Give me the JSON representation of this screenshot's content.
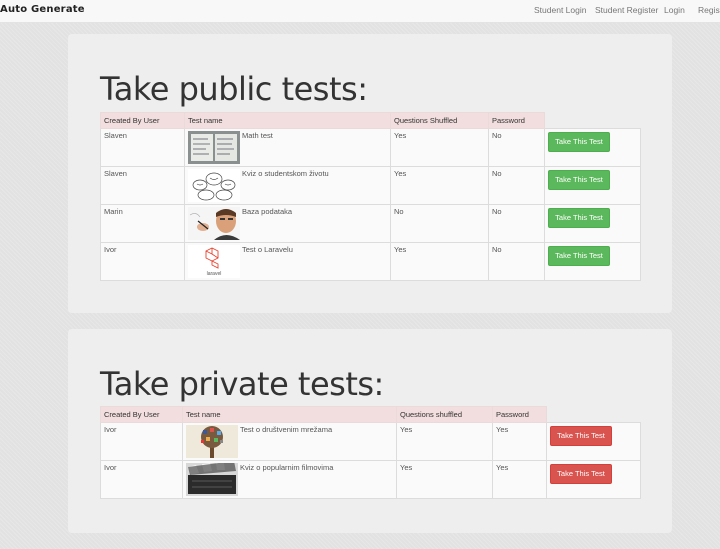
{
  "nav": {
    "brand": "Auto Generate",
    "links": [
      "Student Login",
      "Student Register",
      "Login",
      "Register"
    ]
  },
  "public_section": {
    "title": "Take public tests:",
    "headers": [
      "Created By User",
      "Test name",
      "Questions Shuffled",
      "Password"
    ],
    "rows": [
      {
        "user": "Slaven",
        "test": "Math test",
        "shuffled": "Yes",
        "password": "No",
        "thumb": "math-notes-thumbnail",
        "button": "Take This Test"
      },
      {
        "user": "Slaven",
        "test": "Kviz o studentskom životu",
        "shuffled": "Yes",
        "password": "No",
        "thumb": "student-life-sketch-thumbnail",
        "button": "Take This Test"
      },
      {
        "user": "Marin",
        "test": "Baza podataka",
        "shuffled": "No",
        "password": "No",
        "thumb": "database-man-thumbnail",
        "button": "Take This Test"
      },
      {
        "user": "Ivor",
        "test": "Test o Laravelu",
        "shuffled": "Yes",
        "password": "No",
        "thumb": "laravel-logo-thumbnail",
        "button": "Take This Test"
      }
    ]
  },
  "private_section": {
    "title": "Take private tests:",
    "headers": [
      "Created By User",
      "Test name",
      "Questions shuffled",
      "Password"
    ],
    "rows": [
      {
        "user": "Ivor",
        "test": "Test o društvenim mrežama",
        "shuffled": "Yes",
        "password": "Yes",
        "thumb": "social-network-tree-thumbnail",
        "button": "Take This Test"
      },
      {
        "user": "Ivor",
        "test": "Kviz o popularnim filmovima",
        "shuffled": "Yes",
        "password": "Yes",
        "thumb": "clapperboard-thumbnail",
        "button": "Take This Test"
      }
    ]
  },
  "laravel_logo_text": "laravel",
  "colors": {
    "public_button": "#5cb85c",
    "private_button": "#d9534f",
    "header_bg": "#f2dede",
    "panel_bg": "#eeeeee"
  }
}
